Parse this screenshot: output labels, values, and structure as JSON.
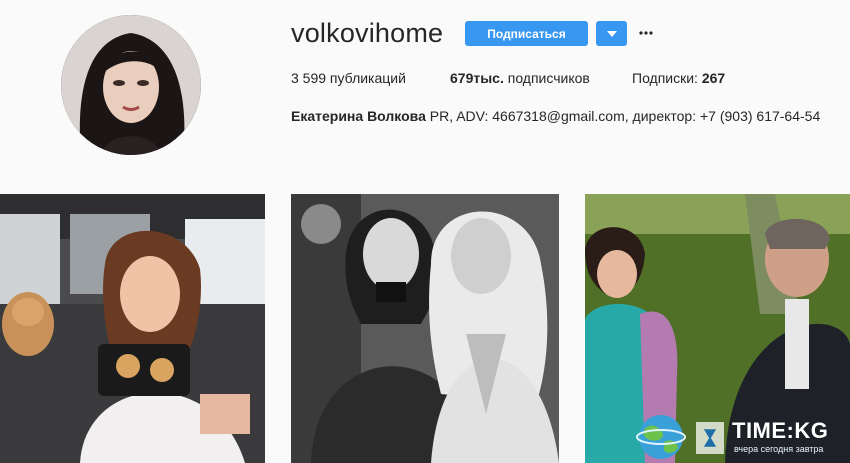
{
  "profile": {
    "username": "volkovihome",
    "follow_label": "Подписаться",
    "posts_count": "3 599",
    "posts_label": " публикаций",
    "followers_count": "679тыс.",
    "followers_label": " подписчиков",
    "following_label": "Подписки: ",
    "following_count": "267",
    "full_name": "Екатерина Волкова",
    "bio": " PR, ADV: 4667318@gmail.com, директор: +7 (903) 617-64-54"
  },
  "icons": {
    "dropdown": "chevron-down-icon",
    "more": "more-horizontal-icon"
  },
  "watermark": {
    "title": "TIME:KG",
    "subtitle": "вчера сегодня завтра"
  },
  "colors": {
    "accent": "#3897f0",
    "background": "#fafafa",
    "text": "#262626"
  }
}
